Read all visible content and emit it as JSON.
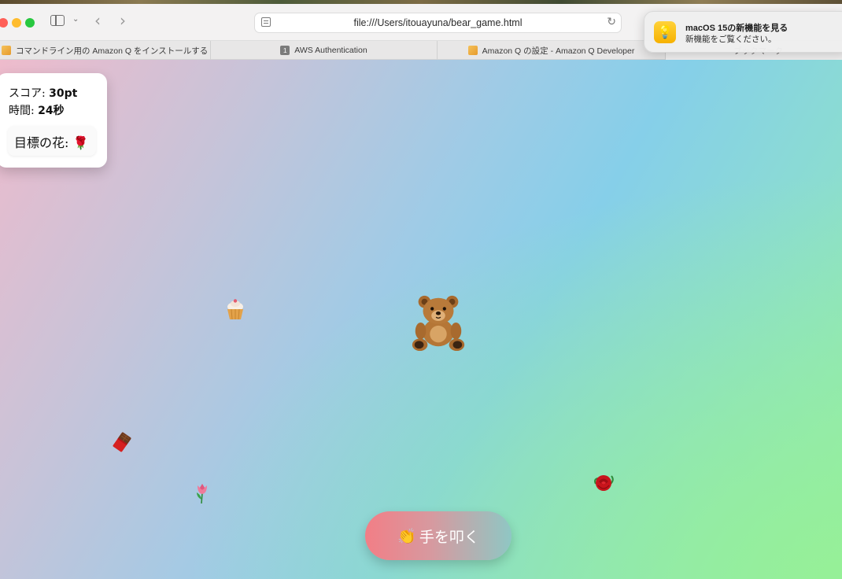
{
  "browser": {
    "url": "file:///Users/itouayuna/bear_game.html",
    "tabs": [
      {
        "label": "コマンドライン用の Amazon Q をインストールする - Amaz..."
      },
      {
        "label": "AWS Authentication",
        "badge": "1"
      },
      {
        "label": "Amazon Q の設定 - Amazon Q Developer"
      },
      {
        "label": "ブックマーク"
      }
    ]
  },
  "notification": {
    "title": "macOS 15の新機能を見る",
    "body": "新機能をご覧ください。",
    "icon": "lightbulb-icon"
  },
  "game": {
    "score_label": "スコア: ",
    "score_value": "30pt",
    "time_label": "時間: ",
    "time_value": "24秒",
    "target_label": "目標の花: ",
    "target_flower": "🌹",
    "clap_icon": "👏",
    "clap_label": "手を叩く",
    "items": {
      "bear": "bear-icon",
      "cupcake": "cupcake-icon",
      "chocolate": "chocolate-icon",
      "tulip": "tulip-icon",
      "rose": "rose-icon"
    }
  },
  "colors": {
    "background_start": "#eebbcc",
    "background_mid": "#86cfe9",
    "background_end": "#93ecb0",
    "button_start": "#f27e86",
    "button_end": "#8fc7c4"
  }
}
